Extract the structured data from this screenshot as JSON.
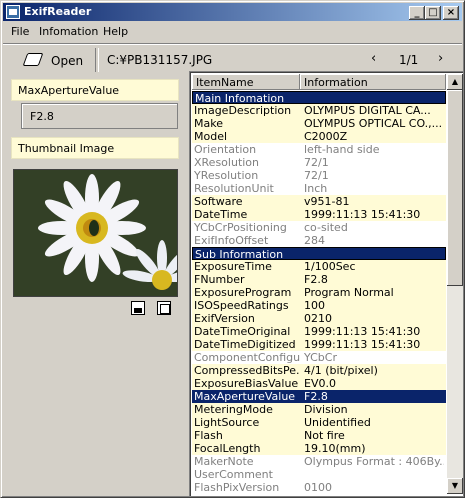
{
  "window": {
    "title": "ExifReader"
  },
  "menu": [
    "File",
    "Infomation",
    "Help"
  ],
  "toolbar": {
    "open_label": "Open",
    "path": "C:¥PB131157.JPG",
    "page": "1/1",
    "prev": "‹",
    "next": "›"
  },
  "left": {
    "field_label": "MaxApertureValue",
    "field_value": "F2.8",
    "thumb_label": "Thumbnail Image"
  },
  "table": {
    "headers": [
      "ItemName",
      "Information"
    ],
    "rows": [
      {
        "type": "section",
        "name": "Main Infomation",
        "value": ""
      },
      {
        "type": "yellow",
        "name": "ImageDescription",
        "value": "OLYMPUS DIGITAL CA..."
      },
      {
        "type": "yellow",
        "name": "Make",
        "value": "OLYMPUS OPTICAL CO.,..."
      },
      {
        "type": "yellow",
        "name": "Model",
        "value": "C2000Z"
      },
      {
        "type": "grey",
        "name": "Orientation",
        "value": "left-hand side"
      },
      {
        "type": "grey",
        "name": "XResolution",
        "value": "72/1"
      },
      {
        "type": "grey",
        "name": "YResolution",
        "value": "72/1"
      },
      {
        "type": "grey",
        "name": "ResolutionUnit",
        "value": "Inch"
      },
      {
        "type": "yellow",
        "name": "Software",
        "value": "v951-81"
      },
      {
        "type": "yellow",
        "name": "DateTime",
        "value": "1999:11:13 15:41:30"
      },
      {
        "type": "grey",
        "name": "YCbCrPositioning",
        "value": "co-sited"
      },
      {
        "type": "grey",
        "name": "ExifInfoOffset",
        "value": "284"
      },
      {
        "type": "section",
        "name": "Sub Information",
        "value": ""
      },
      {
        "type": "yellow",
        "name": "ExposureTime",
        "value": "1/100Sec"
      },
      {
        "type": "yellow",
        "name": "FNumber",
        "value": "F2.8"
      },
      {
        "type": "yellow",
        "name": "ExposureProgram",
        "value": "Program Normal"
      },
      {
        "type": "yellow",
        "name": "ISOSpeedRatings",
        "value": "100"
      },
      {
        "type": "yellow",
        "name": "ExifVersion",
        "value": "0210"
      },
      {
        "type": "yellow",
        "name": "DateTimeOriginal",
        "value": "1999:11:13 15:41:30"
      },
      {
        "type": "yellow",
        "name": "DateTimeDigitized",
        "value": "1999:11:13 15:41:30"
      },
      {
        "type": "grey",
        "name": "ComponentConfigu...",
        "value": "YCbCr"
      },
      {
        "type": "yellow",
        "name": "CompressedBitsPe...",
        "value": "4/1 (bit/pixel)"
      },
      {
        "type": "yellow",
        "name": "ExposureBiasValue",
        "value": "EV0.0"
      },
      {
        "type": "selected",
        "name": "MaxApertureValue",
        "value": "F2.8"
      },
      {
        "type": "yellow",
        "name": "MeteringMode",
        "value": "Division"
      },
      {
        "type": "yellow",
        "name": "LightSource",
        "value": "Unidentified"
      },
      {
        "type": "yellow",
        "name": "Flash",
        "value": "Not fire"
      },
      {
        "type": "yellow",
        "name": "FocalLength",
        "value": "19.10(mm)"
      },
      {
        "type": "grey",
        "name": "MakerNote",
        "value": "Olympus Format : 406By..."
      },
      {
        "type": "grey",
        "name": "UserComment",
        "value": ""
      },
      {
        "type": "grey",
        "name": "FlashPixVersion",
        "value": "0100"
      }
    ]
  }
}
